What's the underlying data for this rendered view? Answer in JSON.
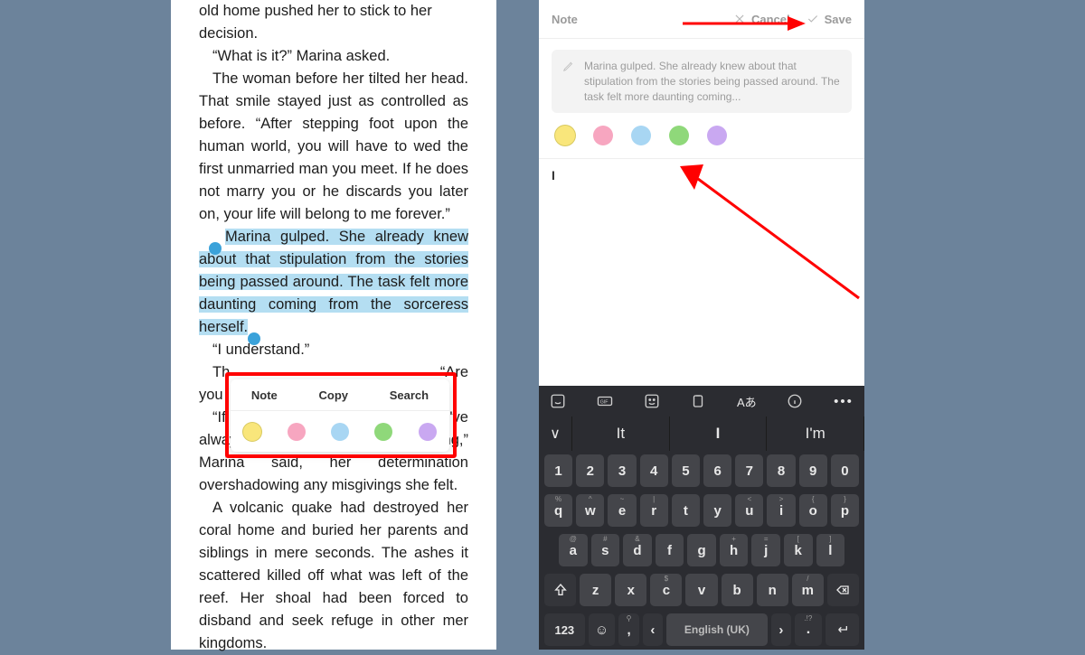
{
  "reader": {
    "p1a": "old home pushed her to stick to her",
    "p1b": "decision.",
    "p2": "“What is it?” Marina asked.",
    "p3": "The woman before her tilted her head. That smile stayed just as controlled as before. “After stepping foot upon the human world, you will have to wed the first unmarried man you meet. If he does not marry you or he discards you later on, your life will belong to me forever.”",
    "hl": "Marina gulped. She already knew about that stipulation from the stories being passed around. The task felt more daunting coming from the sorceress herself.",
    "p5": "“I understand.”",
    "p6a": "Th",
    "p6b": "“Are",
    "p7a": "you ",
    "p8a": "“If ",
    "p8b": "t I've",
    "p9": "always wanted, I will do anything,” Marina said, her determination overshadowing any misgivings she felt.",
    "p10": "A volcanic quake had destroyed her coral home and buried her parents and siblings in mere seconds. The ashes it scattered killed off what was left of the reef. Her shoal had been forced to disband and seek refuge in other mer kingdoms."
  },
  "popup": {
    "note": "Note",
    "copy": "Copy",
    "search": "Search"
  },
  "colors": {
    "yellow": "#f9e67b",
    "pink": "#f7a6c0",
    "blue": "#a8d6f3",
    "green": "#8fd87a",
    "purple": "#c9a8f1"
  },
  "note_screen": {
    "title": "Note",
    "cancel": "Cancel",
    "save": "Save",
    "quote": "Marina gulped. She already knew about that stipulation from the stories being passed around. The task felt more daunting coming...",
    "typed": "I"
  },
  "keyboard": {
    "suggestions": [
      "∨",
      "It",
      "I",
      "I'm"
    ],
    "row_num": [
      "1",
      "2",
      "3",
      "4",
      "5",
      "6",
      "7",
      "8",
      "9",
      "0"
    ],
    "row1": [
      "q",
      "w",
      "e",
      "r",
      "t",
      "y",
      "u",
      "i",
      "o",
      "p"
    ],
    "row1_alt": [
      "%",
      "^",
      "~",
      "|",
      "",
      "",
      "<",
      ">",
      "{",
      "}"
    ],
    "row2": [
      "a",
      "s",
      "d",
      "f",
      "g",
      "h",
      "j",
      "k",
      "l"
    ],
    "row2_alt": [
      "@",
      "#",
      "&",
      "",
      "",
      "+",
      "=",
      "[",
      "]"
    ],
    "row3": [
      "z",
      "x",
      "c",
      "v",
      "b",
      "n",
      "m"
    ],
    "row3_alt": [
      "",
      "",
      "$",
      "",
      "",
      "",
      "/"
    ],
    "mode": "123",
    "space": "English (UK)",
    "punct": ".!?"
  }
}
